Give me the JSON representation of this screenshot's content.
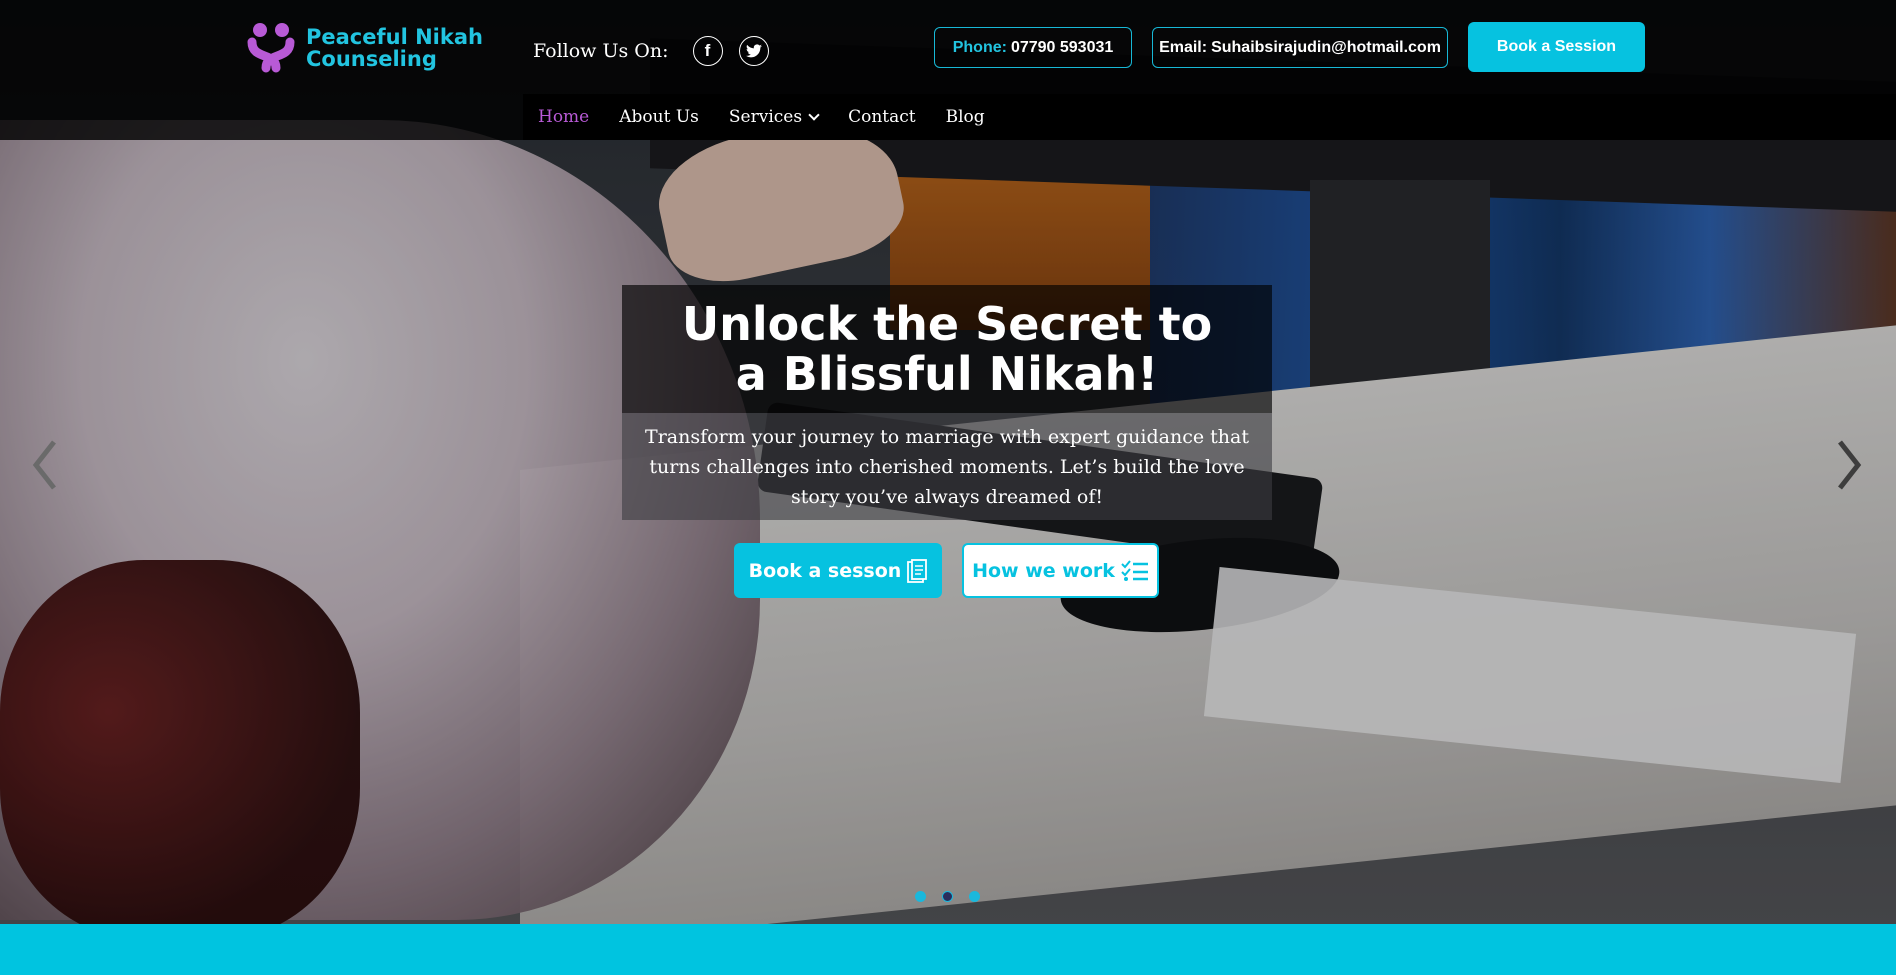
{
  "brand": {
    "line1": "Peaceful Nikah",
    "line2": "Counseling"
  },
  "follow": {
    "label": "Follow Us On:",
    "facebook": "f"
  },
  "contact": {
    "phone_label": "Phone:",
    "phone_value": "07790 593031",
    "email_label": "Email:",
    "email_value": "Suhaibsirajudin@hotmail.com"
  },
  "header_cta": "Book a Session",
  "nav": {
    "home": "Home",
    "about": "About Us",
    "services": "Services",
    "contact": "Contact",
    "blog": "Blog"
  },
  "hero": {
    "title": "Unlock the Secret to a Blissful Nikah!",
    "subtitle": "Transform your journey to marriage with expert guidance that turns challenges into cherished moments. Let’s build the love story you’ve always dreamed of!",
    "book_button": "Book a sesson",
    "how_button": "How we work",
    "slide_count": 3,
    "active_slide": 2
  },
  "colors": {
    "accent": "#06c2e0",
    "brand_purple": "#b85ad6",
    "header_bg": "#000000"
  },
  "icons": [
    "facebook-icon",
    "twitter-icon",
    "chevron-down-icon",
    "document-icon",
    "checklist-icon",
    "arrow-left-icon",
    "arrow-right-icon"
  ]
}
